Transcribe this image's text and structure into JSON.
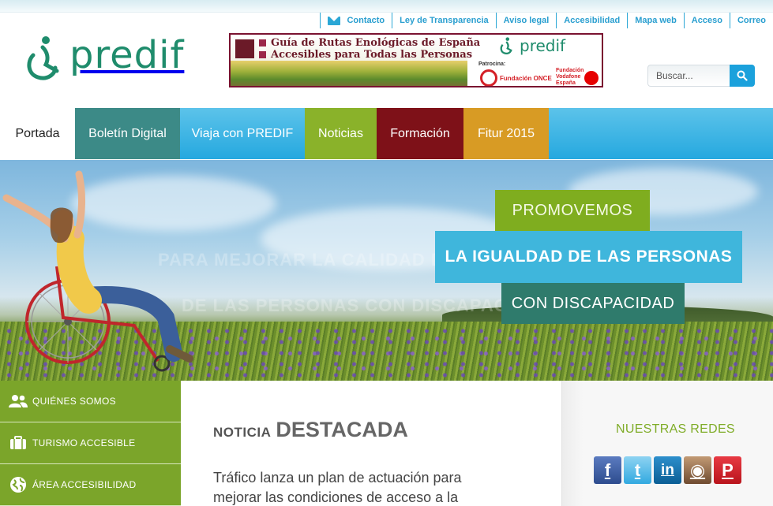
{
  "util_links": [
    "Contacto",
    "Ley de Transparencia",
    "Aviso legal",
    "Accesibilidad",
    "Mapa web",
    "Acceso",
    "Correo"
  ],
  "logo_text": "predif",
  "ad": {
    "line1": "Guía de Rutas Enológicas de España",
    "line2": "Accesibles para Todas las Personas",
    "logo": "predif",
    "patrocina": "Patrocina:",
    "once": "Fundación ONCE",
    "vodafone": "Fundación Vodafone España"
  },
  "search": {
    "placeholder": "Buscar..."
  },
  "nav": [
    "Portada",
    "Boletín Digital",
    "Viaja con PREDIF",
    "Noticias",
    "Formación",
    "Fitur 2015"
  ],
  "hero": {
    "tag1": "PROMOVEMOS",
    "tag2": "LA IGUALDAD DE LAS PERSONAS",
    "tag3": "CON DISCAPACIDAD",
    "ghost1": "PARA MEJORAR LA CALIDAD DE",
    "ghost2": "DE LAS PERSONAS CON DISCAPACIDAD"
  },
  "sidebar": [
    "QUIÉNES SOMOS",
    "TURISMO ACCESIBLE",
    "ÁREA ACCESIBILIDAD"
  ],
  "main": {
    "title_small": "NOTICIA",
    "title_large": "DESTACADA",
    "news_text": "Tráfico lanza un plan de actuación para mejorar las condiciones de acceso a la"
  },
  "right": {
    "title": "NUESTRAS REDES",
    "social": [
      "f",
      "t",
      "in",
      "◉",
      "P"
    ]
  },
  "colors": {
    "accent_blue": "#1ba1dc",
    "green": "#7ba52a",
    "teal": "#3c8a87",
    "maroon": "#7e1118",
    "orange": "#d89b24"
  }
}
